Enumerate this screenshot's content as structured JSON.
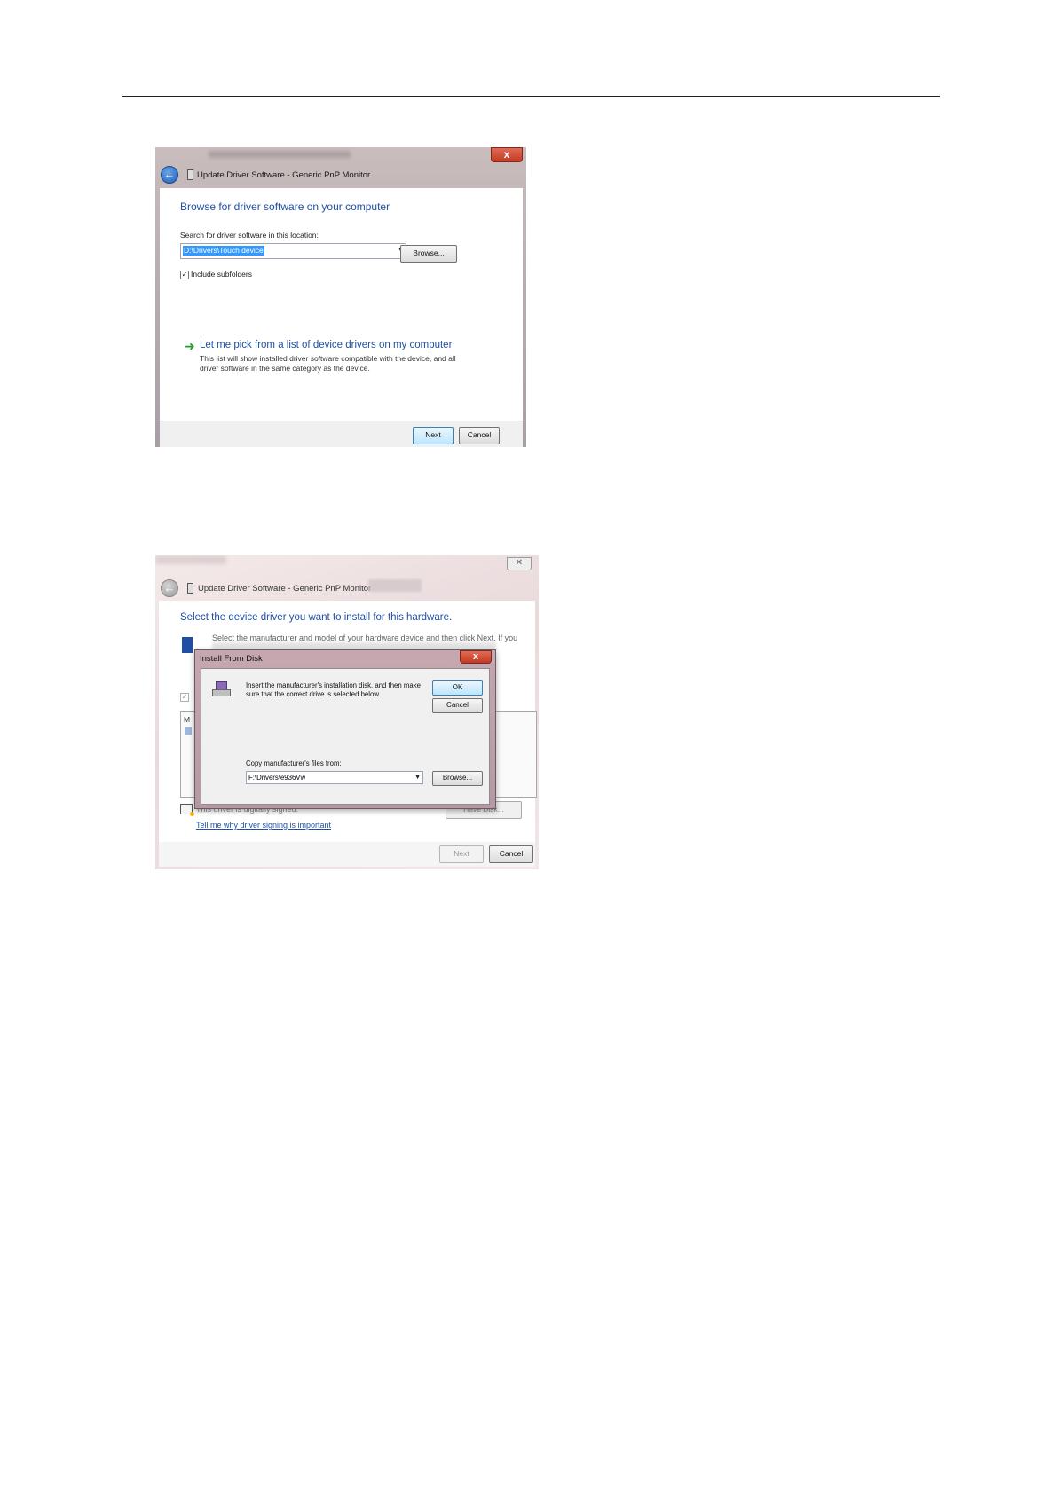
{
  "screenshot1": {
    "window_title": "Update Driver Software - Generic PnP Monitor",
    "close_label": "x",
    "heading": "Browse for driver software on your computer",
    "search_label": "Search for driver software in this location:",
    "path_value": "D:\\Drivers\\Touch device",
    "browse_label": "Browse...",
    "include_subfolders_label": "Include subfolders",
    "include_subfolders_checked": true,
    "pick_link_title": "Let me pick from a list of device drivers on my computer",
    "pick_link_desc": "This list will show installed driver software compatible with the device, and all driver software in the same category as the device.",
    "next_label": "Next",
    "cancel_label": "Cancel"
  },
  "screenshot2": {
    "window_title": "Update Driver Software - Generic PnP Monitor",
    "heading": "Select the device driver you want to install for this hardware.",
    "partial_text": "Select the manufacturer and model of your hardware device and then click Next. If you",
    "list_fragment": "M",
    "not_signed": "This driver is digitally signed.",
    "signing_link": "Tell me why driver signing is important",
    "have_disk_label": "Have Disk...",
    "next_label": "Next",
    "cancel_label": "Cancel",
    "install_from_disk": {
      "title": "Install From Disk",
      "close_label": "x",
      "message": "Insert the manufacturer's installation disk, and then make sure that the correct drive is selected below.",
      "ok_label": "OK",
      "cancel_label": "Cancel",
      "copy_label": "Copy manufacturer's files from:",
      "path_value": "F:\\Drivers\\e936Vw",
      "browse_label": "Browse..."
    }
  },
  "icons": [
    "back-arrow-icon",
    "device-icon",
    "close-icon",
    "dropdown-arrow-icon",
    "green-arrow-icon",
    "disk-drive-icon",
    "monitor-icon",
    "certificate-icon"
  ]
}
